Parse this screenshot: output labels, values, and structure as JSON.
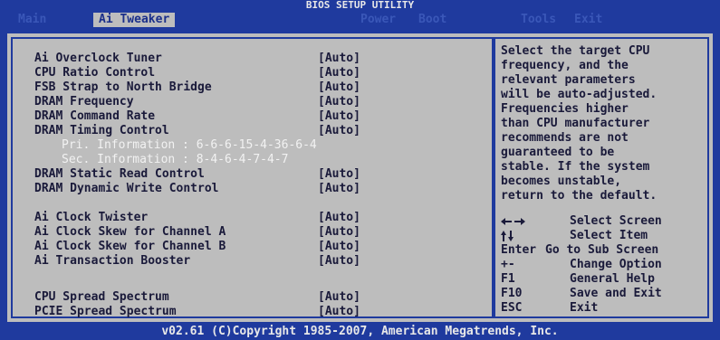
{
  "title": "BIOS SETUP UTILITY",
  "menu": [
    "Main",
    "Ai Tweaker",
    "Power",
    "Boot",
    "Tools",
    "Exit"
  ],
  "settings": [
    {
      "label": "Ai Overclock Tuner",
      "value": "[Auto]"
    },
    {
      "label": "CPU Ratio Control",
      "value": "[Auto]"
    },
    {
      "label": "FSB Strap to North Bridge",
      "value": "[Auto]"
    },
    {
      "label": "DRAM Frequency",
      "value": "[Auto]"
    },
    {
      "label": "DRAM Command Rate",
      "value": "[Auto]"
    },
    {
      "label": "DRAM Timing Control",
      "value": "[Auto]"
    },
    {
      "label": "Pri. Information : 6-6-6-15-4-36-6-4",
      "value": ""
    },
    {
      "label": "Sec. Information : 8-4-6-4-7-4-7",
      "value": ""
    },
    {
      "label": "DRAM Static Read Control",
      "value": "[Auto]"
    },
    {
      "label": "DRAM Dynamic Write Control",
      "value": "[Auto]"
    },
    {
      "label": "Ai Clock Twister",
      "value": "[Auto]"
    },
    {
      "label": "Ai Clock Skew for Channel A",
      "value": "[Auto]"
    },
    {
      "label": "Ai Clock Skew for Channel B",
      "value": "[Auto]"
    },
    {
      "label": "Ai Transaction Booster",
      "value": "[Auto]"
    },
    {
      "label": "CPU Spread Spectrum",
      "value": "[Auto]"
    },
    {
      "label": "PCIE Spread Spectrum",
      "value": "[Auto]"
    }
  ],
  "help_lines": [
    "Select the target CPU",
    "frequency, and the",
    "relevant parameters",
    "will be auto-adjusted.",
    "Frequencies higher",
    "than CPU manufacturer",
    "recommends are not",
    "guaranteed to be",
    "stable. If the system",
    "becomes unstable,",
    "return to the default."
  ],
  "keys": [
    {
      "icon": "left-right-arrows-icon",
      "key": "",
      "desc": "Select Screen"
    },
    {
      "icon": "up-down-arrows-icon",
      "key": "",
      "desc": "Select Item"
    },
    {
      "icon": "",
      "key": "Enter",
      "desc": "Go to Sub Screen"
    },
    {
      "icon": "",
      "key": "+-",
      "desc": "Change Option"
    },
    {
      "icon": "",
      "key": "F1",
      "desc": "General Help"
    },
    {
      "icon": "",
      "key": "F10",
      "desc": "Save and Exit"
    },
    {
      "icon": "",
      "key": "ESC",
      "desc": "Exit"
    }
  ],
  "footer": "v02.61 (C)Copyright 1985-2007, American Megatrends, Inc.",
  "colors": {
    "background": "#1f3a9e",
    "panel": "#bdbdbd",
    "text": "#1a1a3a"
  }
}
